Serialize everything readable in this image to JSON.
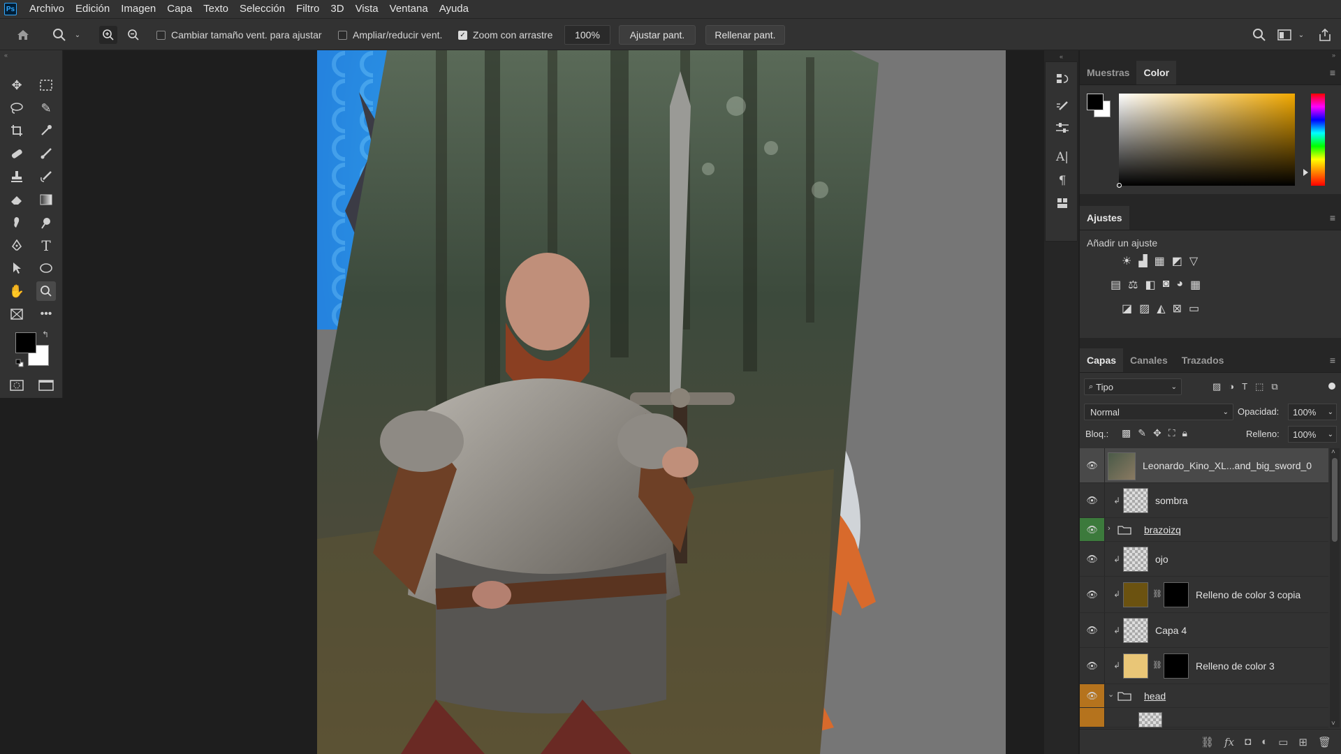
{
  "app": {
    "logo": "Ps"
  },
  "menu": [
    "Archivo",
    "Edición",
    "Imagen",
    "Capa",
    "Texto",
    "Selección",
    "Filtro",
    "3D",
    "Vista",
    "Ventana",
    "Ayuda"
  ],
  "options": {
    "resize_windows_label": "Cambiar tamaño vent. para ajustar",
    "resize_windows_checked": false,
    "zoom_all_label": "Ampliar/reducir vent.",
    "zoom_all_checked": false,
    "scrubby_zoom_label": "Zoom con arrastre",
    "scrubby_zoom_checked": true,
    "zoom_value": "100%",
    "fit_screen_label": "Ajustar pant.",
    "fill_screen_label": "Rellenar pant."
  },
  "panels": {
    "swatches_tab": "Muestras",
    "color_tab": "Color",
    "adjustments_title": "Ajustes",
    "add_adjustment_label": "Añadir un ajuste",
    "layers_tab": "Capas",
    "channels_tab": "Canales",
    "paths_tab": "Trazados"
  },
  "layers_panel": {
    "filter_kind": "Tipo",
    "blend_mode": "Normal",
    "opacity_label": "Opacidad:",
    "opacity_value": "100%",
    "lock_label": "Bloq.:",
    "fill_label": "Relleno:",
    "fill_value": "100%"
  },
  "layers": [
    {
      "name": "Leonardo_Kino_XL...and_big_sword_0",
      "type": "image",
      "selected": true
    },
    {
      "name": "sombra",
      "type": "pixel",
      "clipped": true
    },
    {
      "name": "brazoizq",
      "type": "group",
      "eye_color": "green"
    },
    {
      "name": "ojo",
      "type": "pixel",
      "clipped": true
    },
    {
      "name": "Relleno de color 3 copia",
      "type": "fill",
      "fill_color": "#6b5210",
      "clipped": true
    },
    {
      "name": "Capa 4",
      "type": "pixel",
      "clipped": true
    },
    {
      "name": "Relleno de color 3",
      "type": "fill",
      "fill_color": "#e9c677",
      "clipped": true
    },
    {
      "name": "head",
      "type": "group",
      "eye_color": "orange",
      "expanded": true
    }
  ],
  "colors": {
    "foreground": "#000000",
    "background": "#ffffff",
    "picker_hue": "#f2a900"
  }
}
